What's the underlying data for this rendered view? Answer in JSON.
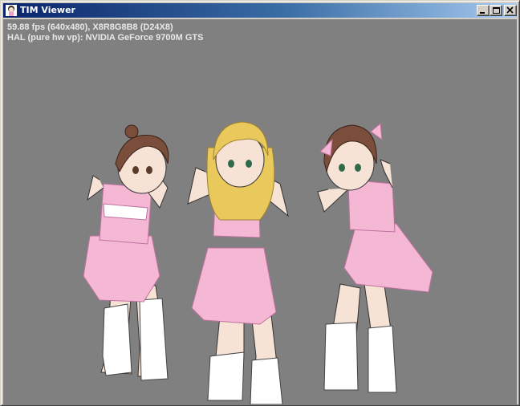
{
  "window": {
    "title": "TIM Viewer",
    "icon": "app-character-icon",
    "buttons": {
      "minimize": "minimize-icon",
      "maximize": "maximize-icon",
      "close": "close-icon"
    }
  },
  "viewport": {
    "background_color": "#808080",
    "stats_line_1": "59.88 fps (640x480), X8R8G8B8 (D24X8)",
    "stats_line_2": "HAL (pure hw vp): NVIDIA GeForce 9700M GTS"
  },
  "colors": {
    "titlebar_start": "#0a246a",
    "titlebar_end": "#a6caf0",
    "outfit_pink": "#f4b8d4",
    "hair_blonde": "#e9c85c",
    "hair_brown": "#7a4e3a"
  }
}
